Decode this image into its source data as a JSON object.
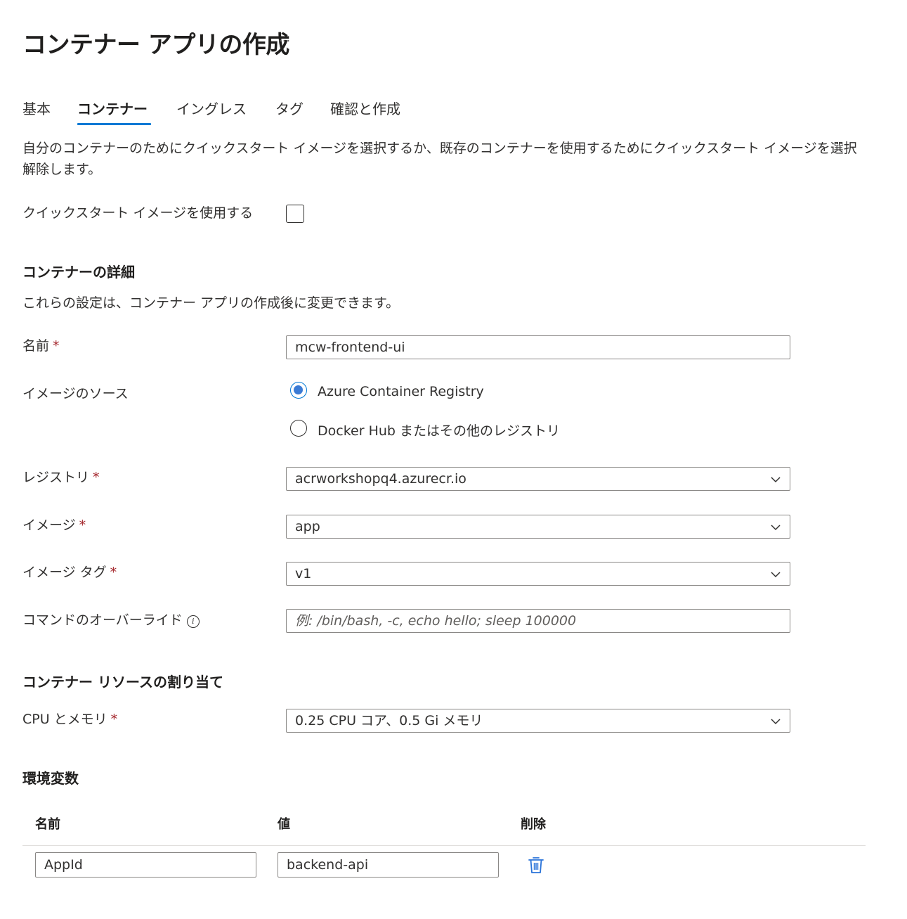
{
  "page": {
    "title": "コンテナー アプリの作成",
    "more": "···"
  },
  "tabs": [
    {
      "label": "基本"
    },
    {
      "label": "コンテナー"
    },
    {
      "label": "イングレス"
    },
    {
      "label": "タグ"
    },
    {
      "label": "確認と作成"
    }
  ],
  "intro": "自分のコンテナーのためにクイックスタート イメージを選択するか、既存のコンテナーを使用するためにクイックスタート イメージを選択解除します。",
  "quickstart": {
    "label": "クイックスタート イメージを使用する",
    "checked": false
  },
  "details": {
    "heading": "コンテナーの詳細",
    "note": "これらの設定は、コンテナー アプリの作成後に変更できます。"
  },
  "form": {
    "name": {
      "label": "名前",
      "required": "*",
      "value": "mcw-frontend-ui"
    },
    "image_source": {
      "label": "イメージのソース",
      "options": [
        {
          "label": "Azure Container Registry",
          "selected": true
        },
        {
          "label": "Docker Hub またはその他のレジストリ",
          "selected": false
        }
      ]
    },
    "registry": {
      "label": "レジストリ",
      "required": "*",
      "value": "acrworkshopq4.azurecr.io"
    },
    "image": {
      "label": "イメージ",
      "required": "*",
      "value": "app"
    },
    "image_tag": {
      "label": "イメージ タグ",
      "required": "*",
      "value": "v1"
    },
    "command": {
      "label": "コマンドのオーバーライド",
      "info": "i",
      "value": "",
      "placeholder": "例: /bin/bash, -c, echo hello; sleep 100000"
    }
  },
  "resources": {
    "heading": "コンテナー リソースの割り当て",
    "cpu": {
      "label": "CPU とメモリ",
      "required": "*",
      "value": "0.25 CPU コア、0.5 Gi メモリ"
    }
  },
  "env": {
    "heading": "環境変数",
    "columns": [
      "名前",
      "値",
      "削除"
    ],
    "rows": [
      {
        "name": "AppId",
        "value": "backend-api"
      }
    ]
  },
  "colors": {
    "accent": "#0078d4",
    "required": "#a4262c",
    "text": "#323130"
  }
}
